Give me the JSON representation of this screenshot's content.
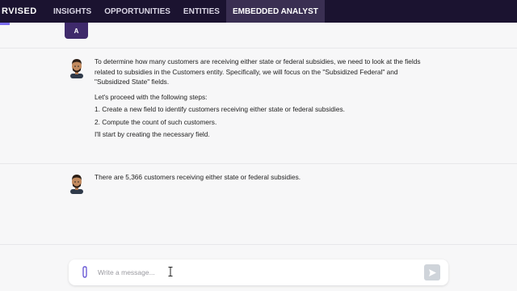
{
  "nav": {
    "brand": "RVISED",
    "items": [
      {
        "label": "INSIGHTS"
      },
      {
        "label": "OPPORTUNITIES"
      },
      {
        "label": "ENTITIES"
      },
      {
        "label": "EMBEDDED ANALYST"
      }
    ],
    "active_index": 3
  },
  "user_avatar": {
    "initial": "A"
  },
  "messages": [
    {
      "paragraphs": [
        "To determine how many customers are receiving either state or federal subsidies, we need to look at the fields related to subsidies in the Customers entity. Specifically, we will focus on the \"Subsidized Federal\" and \"Subsidized State\" fields.",
        "Let's proceed with the following steps:",
        "1. Create a new field to identify customers receiving either state or federal subsidies.",
        "2. Compute the count of such customers.",
        "I'll start by creating the necessary field."
      ]
    },
    {
      "paragraphs": [
        "There are 5,366 customers receiving either state or federal subsidies."
      ]
    }
  ],
  "composer": {
    "placeholder": "Write a message..."
  },
  "colors": {
    "nav_bg": "#1b1330",
    "nav_active": "#3a2f52",
    "accent": "#7b6cf0",
    "send_button": "#cfd4da"
  }
}
